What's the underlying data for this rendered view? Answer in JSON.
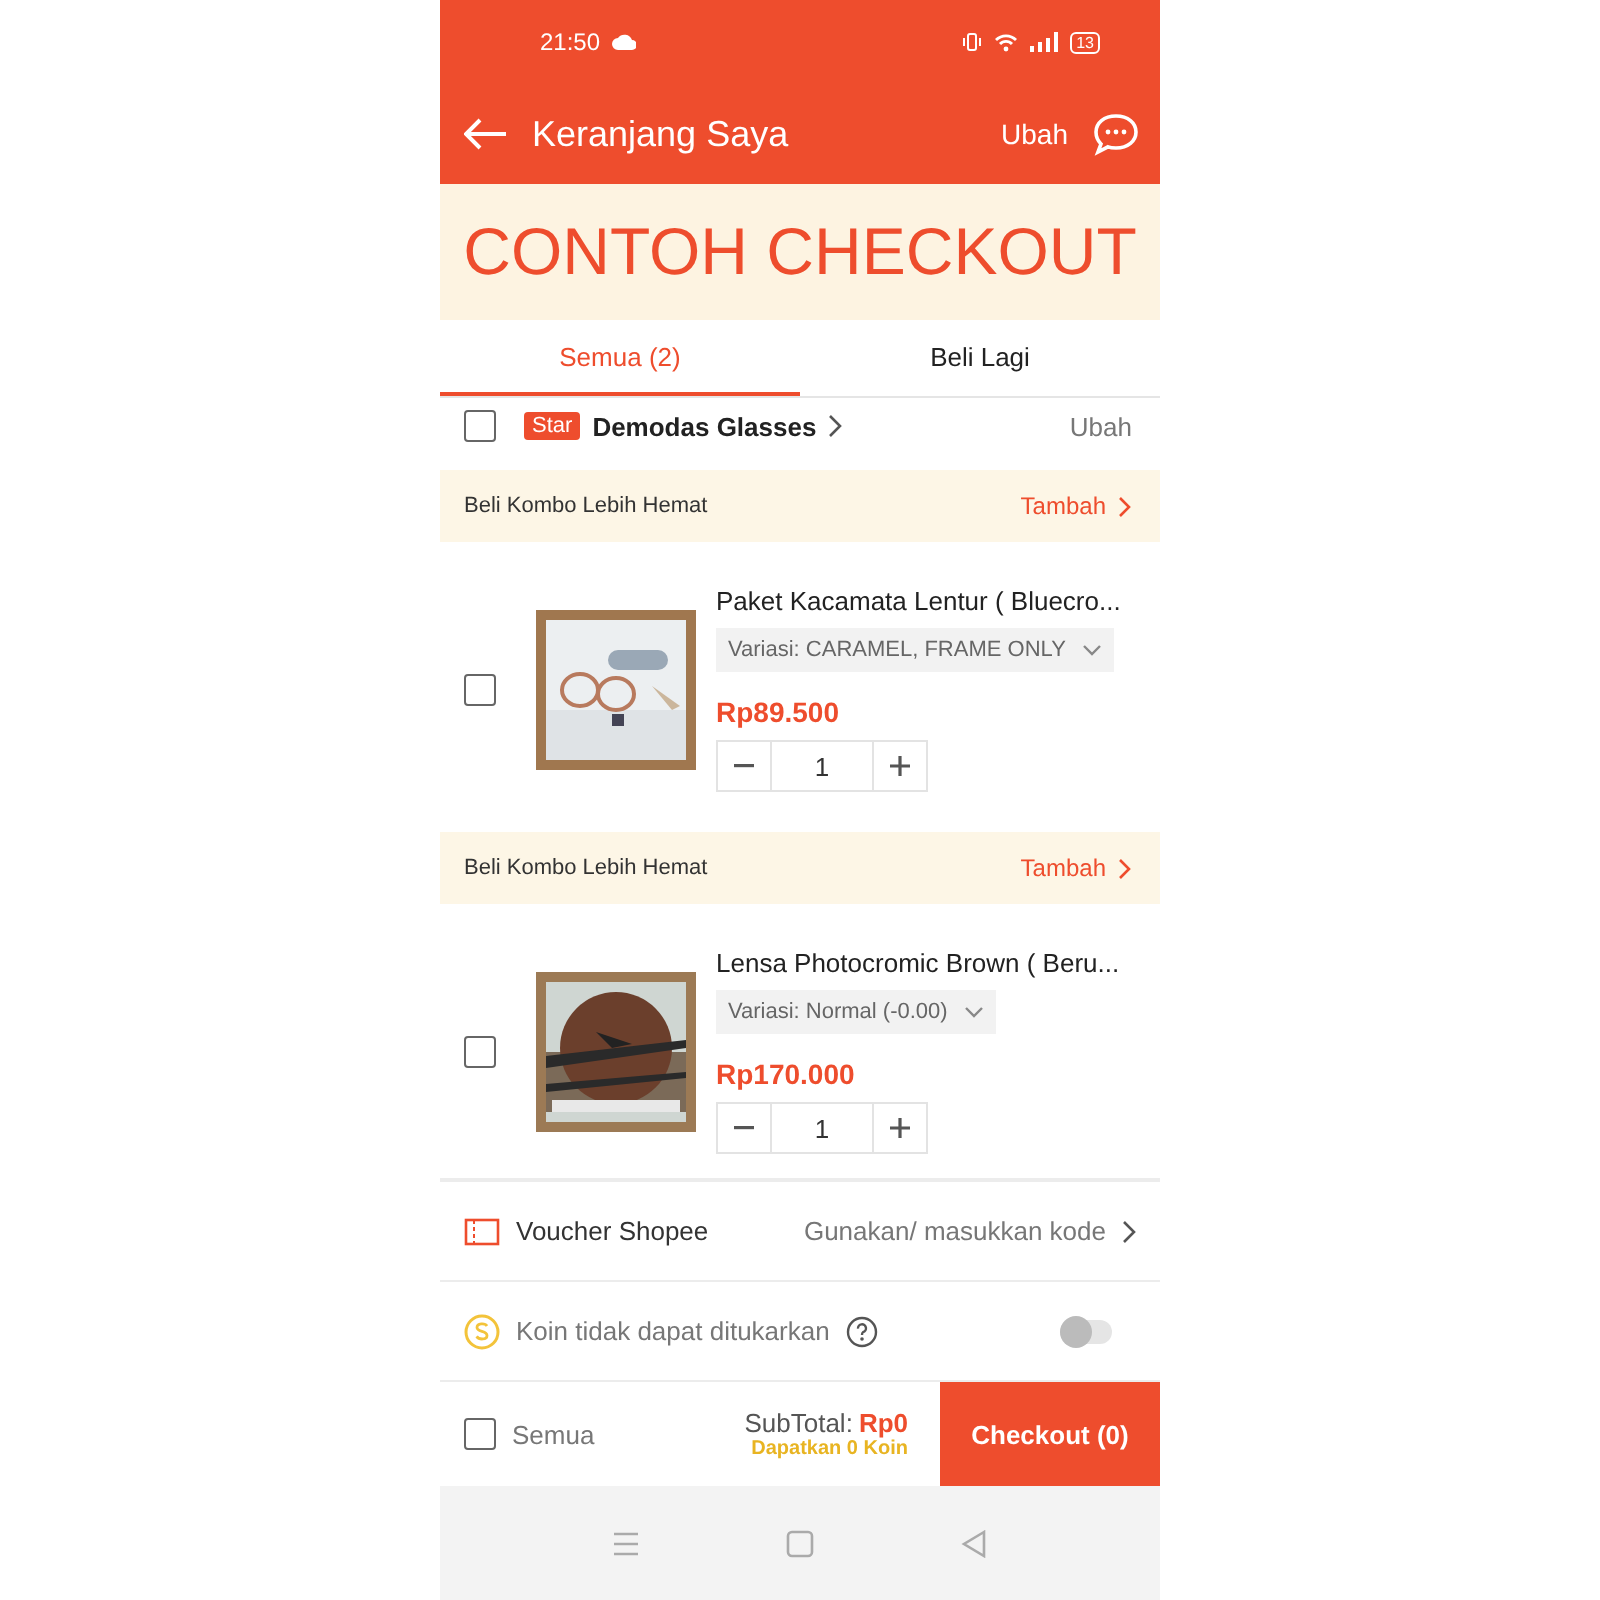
{
  "status_bar": {
    "time": "21:50",
    "battery": "13"
  },
  "header": {
    "title": "Keranjang Saya",
    "action": "Ubah"
  },
  "banner": {
    "text": "CONTOH CHECKOUT"
  },
  "tabs": [
    {
      "label": "Semua (2)",
      "selected": true
    },
    {
      "label": "Beli Lagi",
      "selected": false
    }
  ],
  "shop": {
    "badge": "Star",
    "name": "Demodas Glasses",
    "checked": false,
    "action": "Ubah"
  },
  "groups": [
    {
      "promo": "Beli Kombo Lebih Hemat",
      "promo_action": "Tambah",
      "item": {
        "checked": false,
        "name": "Paket Kacamata Lentur ( Bluecro...",
        "variant": "Variasi: CARAMEL, FRAME ONLY",
        "price": "Rp89.500",
        "quantity": "1"
      }
    },
    {
      "promo": "Beli Kombo Lebih Hemat",
      "promo_action": "Tambah",
      "item": {
        "checked": false,
        "name": "Lensa Photocromic Brown ( Beru...",
        "variant": "Variasi: Normal (-0.00)",
        "price": "Rp170.000",
        "quantity": "1"
      }
    }
  ],
  "voucher": {
    "label": "Voucher Shopee",
    "action": "Gunakan/ masukkan kode"
  },
  "coins": {
    "label": "Koin tidak dapat ditukarkan",
    "on": false
  },
  "footer": {
    "select_all": "Semua",
    "checked": false,
    "subtotal_label": "SubTotal:",
    "subtotal": "Rp0",
    "coins_note": "Dapatkan 0 Koin",
    "checkout": "Checkout (0)"
  }
}
